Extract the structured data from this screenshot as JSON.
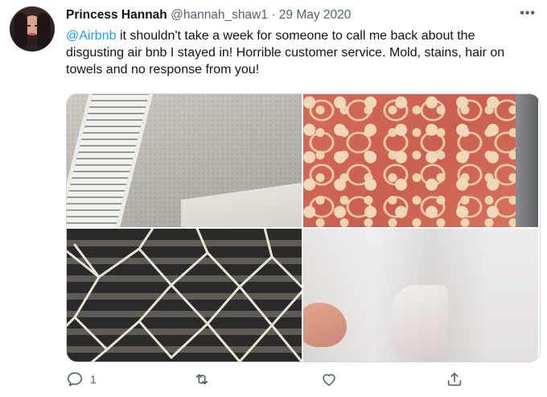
{
  "tweet": {
    "author_name": "Princess Hannah",
    "handle": "@hannah_shaw1",
    "separator": "·",
    "date": "29 May 2020",
    "more_label": "•••",
    "mention": "@Airbnb",
    "body": " it shouldn't take a week for someone to call me back about the disgusting air bnb I stayed in! Horrible customer service. Mold, stains, hair on towels and no response from you!",
    "reply_count": "1"
  },
  "icons": [
    "more-icon",
    "reply-icon",
    "retweet-icon",
    "like-icon",
    "share-icon"
  ],
  "colors": {
    "text": "#0f1419",
    "muted": "#536471",
    "link": "#1d9bf0",
    "border": "#cfd9de"
  }
}
